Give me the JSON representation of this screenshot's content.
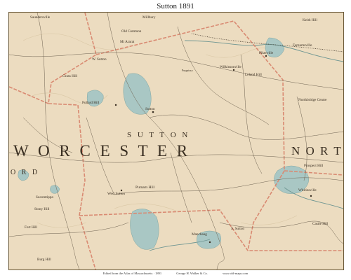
{
  "title": "Sutton   1891",
  "region_labels": {
    "sutton": "S U T T O N",
    "worcester": "W O R C E S T E R",
    "north": "N O R T H",
    "ord": "O R D"
  },
  "place_labels": [
    "Sutton",
    "Putnam Hill",
    "Pikerville",
    "Wilkinsonville",
    "Leland Hill",
    "Purgatory",
    "Whitinsville",
    "Mt Ararat",
    "Keith Hill",
    "Pollard Hill",
    "Fort Hill",
    "Castle Hill",
    "Manchaug",
    "Millbury",
    "Grass Hill",
    "Old Common",
    "Saundersville",
    "Sucomtippo",
    "Stony Hill",
    "West Sutton",
    "Prospect Hill",
    "Northbridge Centre",
    "Farnumsville",
    "W. Sutton",
    "S. Sutton",
    "Burg Hill"
  ],
  "credits": {
    "left": "Edited from the Atlas of Massachusetts · 1891",
    "center": "George H. Walker & Co.",
    "right": "www.old-maps.com"
  },
  "colors": {
    "paper": "#ecdcc0",
    "water": "#a9c7c4",
    "boundary": "#d98a72",
    "roads": "#6e6250",
    "text": "#3a2f22"
  }
}
